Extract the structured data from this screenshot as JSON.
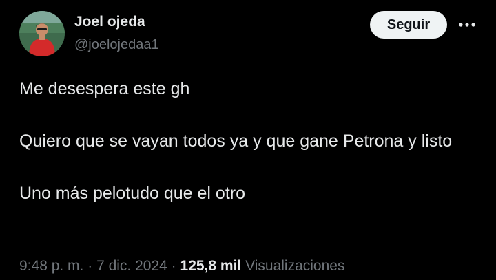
{
  "author": {
    "display_name": "Joel ojeda",
    "handle": "@joelojedaa1",
    "avatar_icon": "user-avatar"
  },
  "actions": {
    "follow_label": "Seguir",
    "more_icon": "more-horizontal-icon"
  },
  "tweet": {
    "paragraphs": [
      "Me desespera este gh",
      "Quiero que se vayan todos ya y que gane Petrona y listo",
      "Uno más pelotudo que el otro"
    ]
  },
  "meta": {
    "time": "9:48 p. m.",
    "separator": "·",
    "date": "7 dic. 2024",
    "views_count": "125,8 mil",
    "views_label": "Visualizaciones"
  },
  "colors": {
    "background": "#000000",
    "primary_text": "#e7e9ea",
    "secondary_text": "#71767b",
    "follow_button_bg": "#eff3f4"
  }
}
